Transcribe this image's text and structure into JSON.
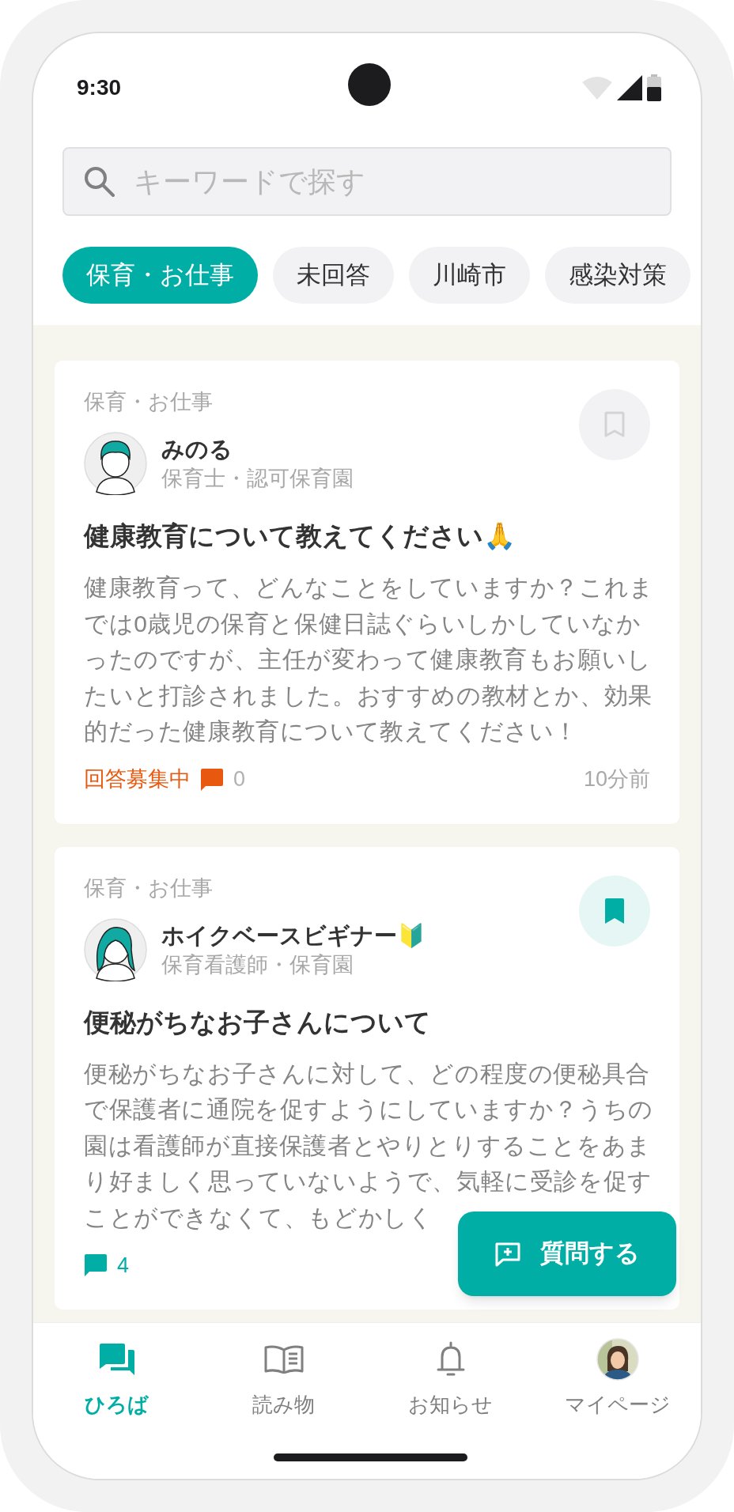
{
  "status_bar": {
    "time": "9:30"
  },
  "search": {
    "placeholder": "キーワードで探す"
  },
  "chips": [
    {
      "label": "保育・お仕事",
      "selected": true
    },
    {
      "label": "未回答",
      "selected": false
    },
    {
      "label": "川崎市",
      "selected": false
    },
    {
      "label": "感染対策",
      "selected": false
    }
  ],
  "posts": [
    {
      "category": "保育・お仕事",
      "avatar": {
        "kind": "short_hair"
      },
      "author": "みのる",
      "author_role": "保育士・認可保育園",
      "bookmarked": false,
      "title": "健康教育について教えてください🙏",
      "body": "健康教育って、どんなことをしていますか？これまでは0歳児の保育と保健日誌ぐらいしかしていなかったのですが、主任が変わって健康教育もお願いしたいと打診されました。おすすめの教材とか、効果的だった健康教育について教えてください！",
      "status": "回答募集中",
      "comment_count": "0",
      "time": "10分前"
    },
    {
      "category": "保育・お仕事",
      "avatar": {
        "kind": "long_hair"
      },
      "author": "ホイクベースビギナー🔰",
      "author_role": "保育看護師・保育園",
      "bookmarked": true,
      "title": "便秘がちなお子さんについて",
      "body": "便秘がちなお子さんに対して、どの程度の便秘具合で保護者に通院を促すようにしていますか？うちの園は看護師が直接保護者とやりとりすることをあまり好ましく思っていないようで、気軽に受診を促すことができなくて、もどかしく",
      "comment_count": "4"
    }
  ],
  "fab": {
    "label": "質問する"
  },
  "nav": [
    {
      "kind": "chat",
      "label": "ひろば",
      "selected": true
    },
    {
      "kind": "book",
      "label": "読み物",
      "selected": false
    },
    {
      "kind": "bell",
      "label": "お知らせ",
      "selected": false
    },
    {
      "kind": "avatar",
      "label": "マイページ",
      "selected": false
    }
  ]
}
